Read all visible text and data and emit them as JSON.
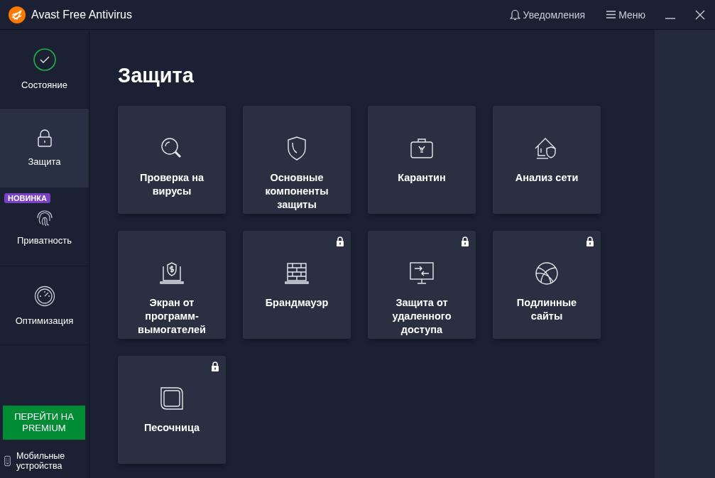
{
  "window": {
    "title": "Avast Free Antivirus",
    "notifications": "Уведомления",
    "menu": "Меню"
  },
  "sidebar": {
    "items": [
      {
        "label": "Состояние",
        "selected": false
      },
      {
        "label": "Защита",
        "selected": true
      },
      {
        "label": "Приватность",
        "selected": false,
        "badge": "НОВИНКА"
      },
      {
        "label": "Оптимизация",
        "selected": false
      }
    ],
    "premium_button": "ПЕРЕЙТИ НА PREMIUM",
    "mobile": "Мобильные устройства"
  },
  "page": {
    "title": "Защита",
    "tiles": [
      {
        "label": "Проверка на вирусы",
        "locked": false
      },
      {
        "label": "Основные компоненты защиты",
        "locked": false
      },
      {
        "label": "Карантин",
        "locked": false
      },
      {
        "label": "Анализ сети",
        "locked": false
      },
      {
        "label": "Экран от программ-вымогателей",
        "locked": false
      },
      {
        "label": "Брандмауэр",
        "locked": true
      },
      {
        "label": "Защита от удаленного доступа",
        "locked": true
      },
      {
        "label": "Подлинные сайты",
        "locked": true
      },
      {
        "label": "Песочница",
        "locked": true
      }
    ]
  }
}
